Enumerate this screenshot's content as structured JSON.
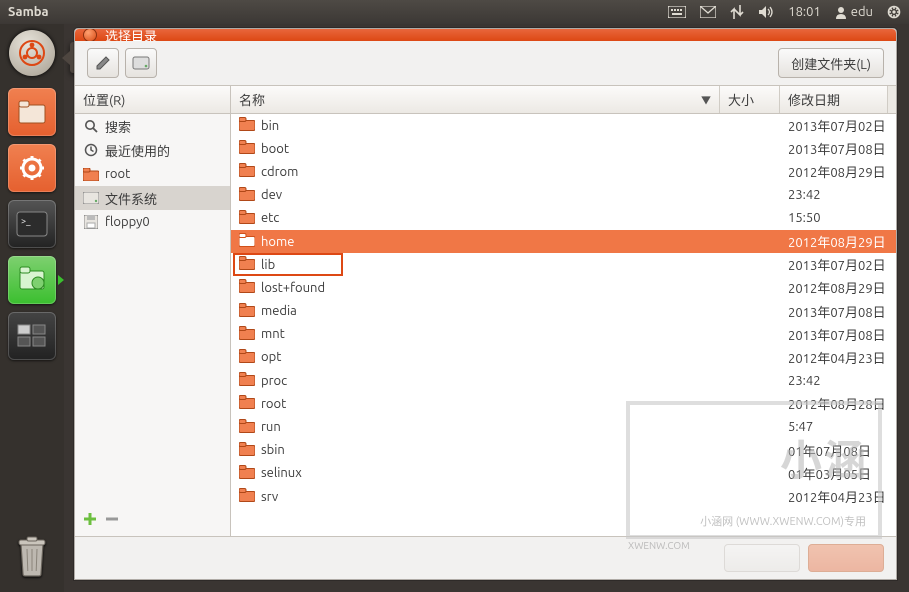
{
  "panel": {
    "title": "Samba",
    "time": "18:01",
    "user": "edu"
  },
  "dash_tooltip": "Dash 主页",
  "dialog": {
    "title": "选择目录",
    "create_folder": "创建文件夹(L)",
    "sidebar": {
      "header": "位置(R)",
      "items": [
        {
          "icon": "search",
          "label": "搜索"
        },
        {
          "icon": "recent",
          "label": "最近使用的"
        },
        {
          "icon": "folder-orange",
          "label": "root"
        },
        {
          "icon": "drive",
          "label": "文件系统",
          "selected": true
        },
        {
          "icon": "floppy",
          "label": "floppy0"
        }
      ]
    },
    "columns": {
      "name": "名称",
      "size": "大小",
      "date": "修改日期"
    },
    "rows": [
      {
        "name": "bin",
        "date": "2013年07月02日"
      },
      {
        "name": "boot",
        "date": "2013年07月08日"
      },
      {
        "name": "cdrom",
        "date": "2012年08月29日"
      },
      {
        "name": "dev",
        "date": "23:42"
      },
      {
        "name": "etc",
        "date": "15:50"
      },
      {
        "name": "home",
        "date": "2012年08月29日",
        "selected": true
      },
      {
        "name": "lib",
        "date": "2013年07月02日"
      },
      {
        "name": "lost+found",
        "date": "2012年08月29日"
      },
      {
        "name": "media",
        "date": "2013年07月08日"
      },
      {
        "name": "mnt",
        "date": "2013年07月08日"
      },
      {
        "name": "opt",
        "date": "2012年04月23日"
      },
      {
        "name": "proc",
        "date": "23:42"
      },
      {
        "name": "root",
        "date": "2012年08月28日"
      },
      {
        "name": "run",
        "date": "5:47"
      },
      {
        "name": "sbin",
        "date": "01年07月08日"
      },
      {
        "name": "selinux",
        "date": "01年03月05日"
      },
      {
        "name": "srv",
        "date": "2012年04月23日"
      }
    ]
  },
  "watermark": {
    "big": "小涵",
    "sub": "小涵网 (WWW.XWENW.COM)专用",
    "corner": "XWENW.COM"
  }
}
